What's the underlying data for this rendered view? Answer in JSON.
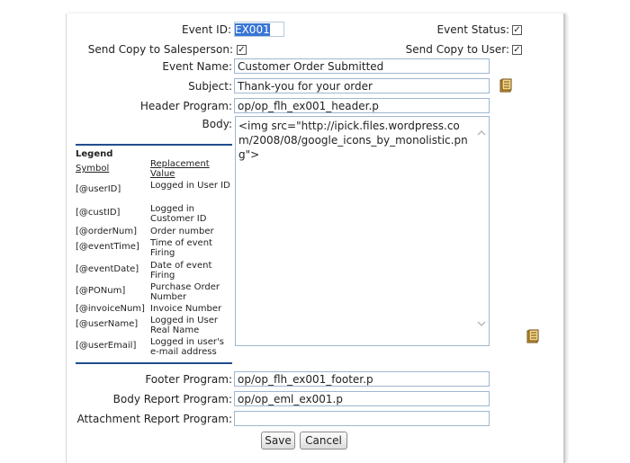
{
  "form": {
    "event_id_label": "Event ID:",
    "event_id_value": "EX001",
    "event_status_label": "Event Status:",
    "event_status_checked": "✓",
    "send_copy_salesperson_label": "Send Copy to Salesperson:",
    "send_copy_salesperson_checked": "✓",
    "send_copy_user_label": "Send Copy to User:",
    "send_copy_user_checked": "✓",
    "event_name_label": "Event Name:",
    "event_name_value": "Customer Order Submitted",
    "subject_label": "Subject:",
    "subject_value": "Thank-you for your order",
    "header_program_label": "Header Program:",
    "header_program_value": "op/op_flh_ex001_header.p",
    "body_label": "Body:",
    "body_value": "<img src=\"http://ipick.files.wordpress.com/2008/08/google_icons_by_monolistic.png\">",
    "footer_program_label": "Footer Program:",
    "footer_program_value": "op/op_flh_ex001_footer.p",
    "body_report_program_label": "Body Report Program:",
    "body_report_program_value": "op/op_eml_ex001.p",
    "attachment_report_program_label": "Attachment Report Program:",
    "attachment_report_program_value": "",
    "save_label": "Save",
    "cancel_label": "Cancel"
  },
  "legend": {
    "title": "Legend",
    "symbol_header": "Symbol",
    "value_header": "Replacement Value",
    "rows": [
      {
        "symbol": "[@userID]",
        "value": "Logged in User ID"
      },
      {
        "symbol": "[@custID]",
        "value": "Logged in Customer ID"
      },
      {
        "symbol": "[@orderNum]",
        "value": "Order number"
      },
      {
        "symbol": "[@eventTime]",
        "value": "Time of event Firing"
      },
      {
        "symbol": "[@eventDate]",
        "value": "Date of event Firing"
      },
      {
        "symbol": "[@PONum]",
        "value": "Purchase Order Number"
      },
      {
        "symbol": "[@invoiceNum]",
        "value": "Invoice Number"
      },
      {
        "symbol": "[@userName]",
        "value": "Logged in User Real Name"
      },
      {
        "symbol": "[@userEmail]",
        "value": "Logged in user's e-mail address"
      }
    ]
  },
  "icons": {
    "subject_lookup": "book-icon",
    "body_lookup": "book-icon"
  },
  "colors": {
    "input_border": "#9fb7cf",
    "selection": "#3875d7",
    "legend_rule": "#1f4e8a"
  }
}
